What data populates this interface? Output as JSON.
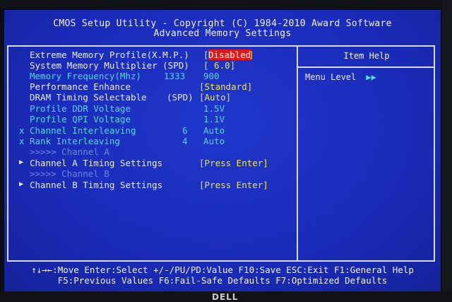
{
  "header": {
    "line1": "CMOS Setup Utility - Copyright (C) 1984-2010 Award Software",
    "line2": "Advanced Memory Settings"
  },
  "items": [
    {
      "label": "Extreme Memory Profile(X.M.P.)",
      "value_open": "[",
      "value": "Disabled",
      "value_close": "]"
    },
    {
      "label": "System Memory Multiplier (SPD)",
      "value": "[ 6.0]"
    },
    {
      "label": "Memory Frequency(Mhz)",
      "col2": "1333",
      "value": "900"
    },
    {
      "label": "Performance Enhance",
      "value": "[Standard]"
    },
    {
      "label": "DRAM Timing Selectable",
      "col2": "(SPD)",
      "value": "[Auto]"
    },
    {
      "label": "Profile DDR Voltage",
      "value": "1.5V"
    },
    {
      "label": "Profile QPI Voltage",
      "value": "1.1V"
    },
    {
      "marker": "x",
      "label": "Channel Interleaving",
      "col2": "6",
      "value": "Auto"
    },
    {
      "marker": "x",
      "label": "Rank Interleaving",
      "col2": "4",
      "value": "Auto"
    },
    {
      "label": ">>>>> Channel A"
    },
    {
      "marker": "▶",
      "label": "Channel A Timing Settings",
      "value": "[Press Enter]"
    },
    {
      "label": ">>>>> Channel B"
    },
    {
      "marker": "▶",
      "label": "Channel B Timing Settings",
      "value": "[Press Enter]"
    }
  ],
  "help": {
    "title": "Item Help",
    "menu_level_label": "Menu Level",
    "menu_level_arrows": "▶▶"
  },
  "footer": {
    "line1": "↑↓→←:Move  Enter:Select  +/-/PU/PD:Value  F10:Save  ESC:Exit  F1:General Help",
    "line2": "F5:Previous Values  F6:Fail-Safe Defaults  F7:Optimized Defaults"
  },
  "monitor": {
    "brand": "DELL"
  },
  "colors": {
    "background": "#1a2ec0",
    "highlight": "#e01818",
    "value_yellow": "#f2e64a",
    "disabled_cyan": "#56d8e2"
  }
}
